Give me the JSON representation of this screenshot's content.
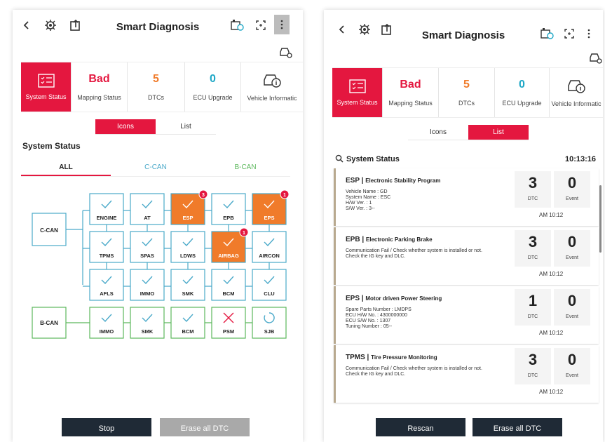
{
  "left": {
    "title": "Smart Diagnosis",
    "summary": [
      {
        "value": "",
        "label": "System Status",
        "active": true,
        "icon": "list-check-icon"
      },
      {
        "value": "Bad",
        "label": "Mapping Status",
        "tone": "red"
      },
      {
        "value": "5",
        "label": "DTCs",
        "tone": "orange"
      },
      {
        "value": "0",
        "label": "ECU Upgrade",
        "tone": "blue"
      },
      {
        "value": "",
        "label": "Vehicle Informatic",
        "icon": "car-info-icon"
      }
    ],
    "view_toggle": {
      "icons": "Icons",
      "list": "List",
      "selected": "Icons"
    },
    "section_title": "System Status",
    "tabs": [
      "ALL",
      "C-CAN",
      "B-CAN"
    ],
    "bus_labels": {
      "ccan": "C-CAN",
      "bcan": "B-CAN"
    },
    "ccan_modules": [
      {
        "name": "ENGINE",
        "status": "ok"
      },
      {
        "name": "AT",
        "status": "ok"
      },
      {
        "name": "ESP",
        "status": "fault",
        "badge": "3"
      },
      {
        "name": "EPB",
        "status": "ok"
      },
      {
        "name": "EPS",
        "status": "fault",
        "badge": "1"
      },
      {
        "name": "TPMS",
        "status": "ok"
      },
      {
        "name": "SPAS",
        "status": "ok"
      },
      {
        "name": "LDWS",
        "status": "ok"
      },
      {
        "name": "AIRBAG",
        "status": "fault",
        "badge": "1"
      },
      {
        "name": "AIRCON",
        "status": "ok"
      },
      {
        "name": "AFLS",
        "status": "ok"
      },
      {
        "name": "IMMO",
        "status": "ok"
      },
      {
        "name": "SMK",
        "status": "ok"
      },
      {
        "name": "BCM",
        "status": "ok"
      },
      {
        "name": "CLU",
        "status": "ok"
      }
    ],
    "bcan_modules": [
      {
        "name": "IMMO",
        "status": "ok"
      },
      {
        "name": "SMK",
        "status": "ok"
      },
      {
        "name": "BCM",
        "status": "ok"
      },
      {
        "name": "PSM",
        "status": "error"
      },
      {
        "name": "SJB",
        "status": "loading"
      }
    ],
    "buttons": {
      "stop": "Stop",
      "erase": "Erase all DTC"
    }
  },
  "right": {
    "title": "Smart Diagnosis",
    "summary": [
      {
        "value": "",
        "label": "System Status",
        "active": true
      },
      {
        "value": "Bad",
        "label": "Mapping Status",
        "tone": "red"
      },
      {
        "value": "5",
        "label": "DTCs",
        "tone": "orange"
      },
      {
        "value": "0",
        "label": "ECU Upgrade",
        "tone": "blue"
      },
      {
        "value": "",
        "label": "Vehicle Informatic"
      }
    ],
    "view_toggle": {
      "icons": "Icons",
      "list": "List",
      "selected": "List"
    },
    "section_title": "System Status",
    "time": "10:13:16",
    "cards": [
      {
        "code": "ESP",
        "name": "Electronic Stability Program",
        "lines": [
          "Vehicle Name : GD",
          "System Name : ESC",
          "H/W Ver. : 1",
          "S/W Ver. : 3--"
        ],
        "dtc": "3",
        "event": "0",
        "time": "AM 10:12"
      },
      {
        "code": "EPB",
        "name": "Electronic Parking Brake",
        "lines": [
          "Communication Fail / Check whether system is installed or not.",
          "Check the IG key and DLC."
        ],
        "dtc": "3",
        "event": "0",
        "time": "AM 10:12"
      },
      {
        "code": "EPS",
        "name": "Motor driven Power Steering",
        "lines": [
          "Spare Parts Number : LMDPS",
          "ECU H/W No. : 4300000000",
          "ECU S/W No. : 1307",
          "Tuning Number : 05--"
        ],
        "dtc": "1",
        "event": "0",
        "time": "AM 10:12"
      },
      {
        "code": "TPMS",
        "name": "Tire Pressure Monitoring",
        "lines": [
          "Communication Fail / Check whether system is installed or not.",
          "Check the IG key and DLC."
        ],
        "dtc": "3",
        "event": "0",
        "time": "AM 10:12"
      }
    ],
    "box_labels": {
      "dtc": "DTC",
      "event": "Event"
    },
    "buttons": {
      "rescan": "Rescan",
      "erase": "Erase all DTC"
    }
  },
  "colors": {
    "accent": "#e4173f",
    "fault": "#f07b2a",
    "ccan_line": "#4aa9c9",
    "bcan_line": "#5cb85c",
    "dark_button": "#1f2a36"
  }
}
